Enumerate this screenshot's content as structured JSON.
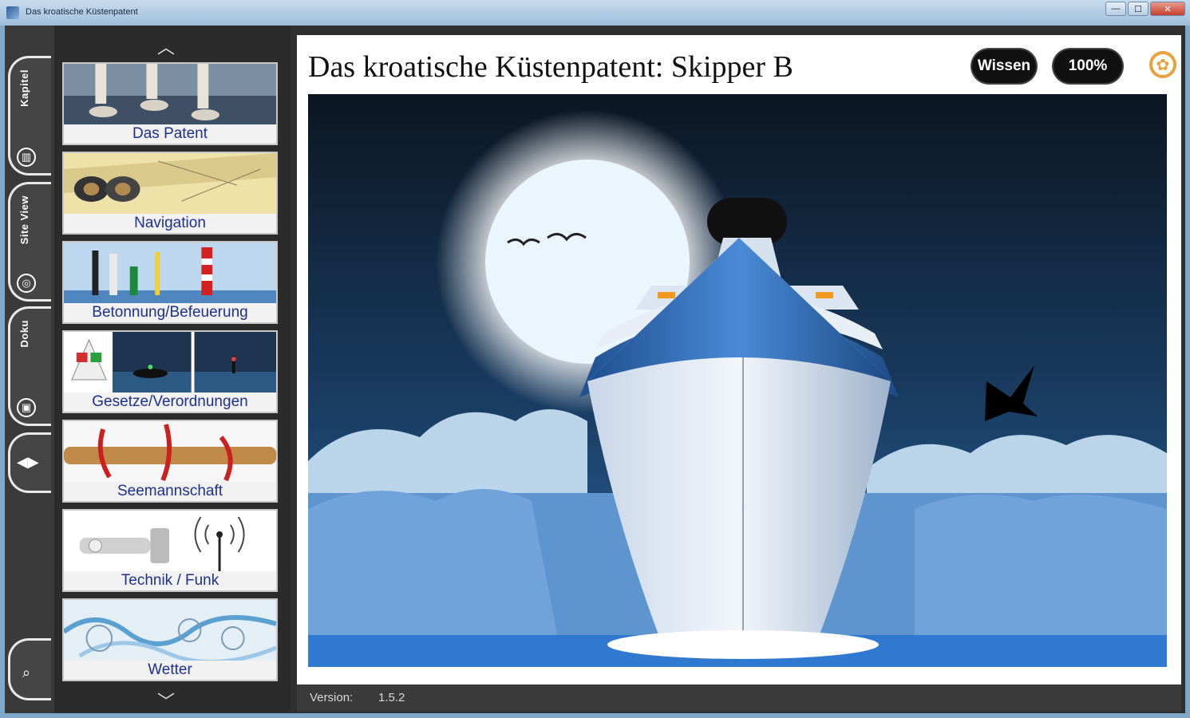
{
  "window": {
    "title": "Das kroatische Küstenpatent",
    "buttons": {
      "minimize": "—",
      "maximize": "☐",
      "close": "✕"
    }
  },
  "rail": {
    "tabs": [
      {
        "label": "Kapitel",
        "icon": "books-icon",
        "glyph": "▥"
      },
      {
        "label": "Site View",
        "icon": "globe-icon",
        "glyph": "◎"
      },
      {
        "label": "Doku",
        "icon": "book-icon",
        "glyph": "▣"
      }
    ],
    "arrows": "◀▶",
    "search_glyph": "⌕"
  },
  "nav": {
    "up": "︿",
    "down": "﹀",
    "items": [
      {
        "label": "Das Patent"
      },
      {
        "label": "Navigation"
      },
      {
        "label": "Betonnung/Befeuerung"
      },
      {
        "label": "Gesetze/Verordnungen"
      },
      {
        "label": "Seemannschaft"
      },
      {
        "label": "Technik / Funk"
      },
      {
        "label": "Wetter"
      }
    ]
  },
  "main": {
    "title": "Das kroatische Küstenpatent: Skipper B",
    "wissen": "Wissen",
    "progress": "100%",
    "gear_glyph": "✿"
  },
  "footer": {
    "version_label": "Version:",
    "version": "1.5.2"
  },
  "colors": {
    "nav_label": "#1e2f8f",
    "sky_top": "#0b1622",
    "sky_bottom": "#1f5a93",
    "sea": "#3f7fc3",
    "ship_blue": "#2f6fb5"
  }
}
